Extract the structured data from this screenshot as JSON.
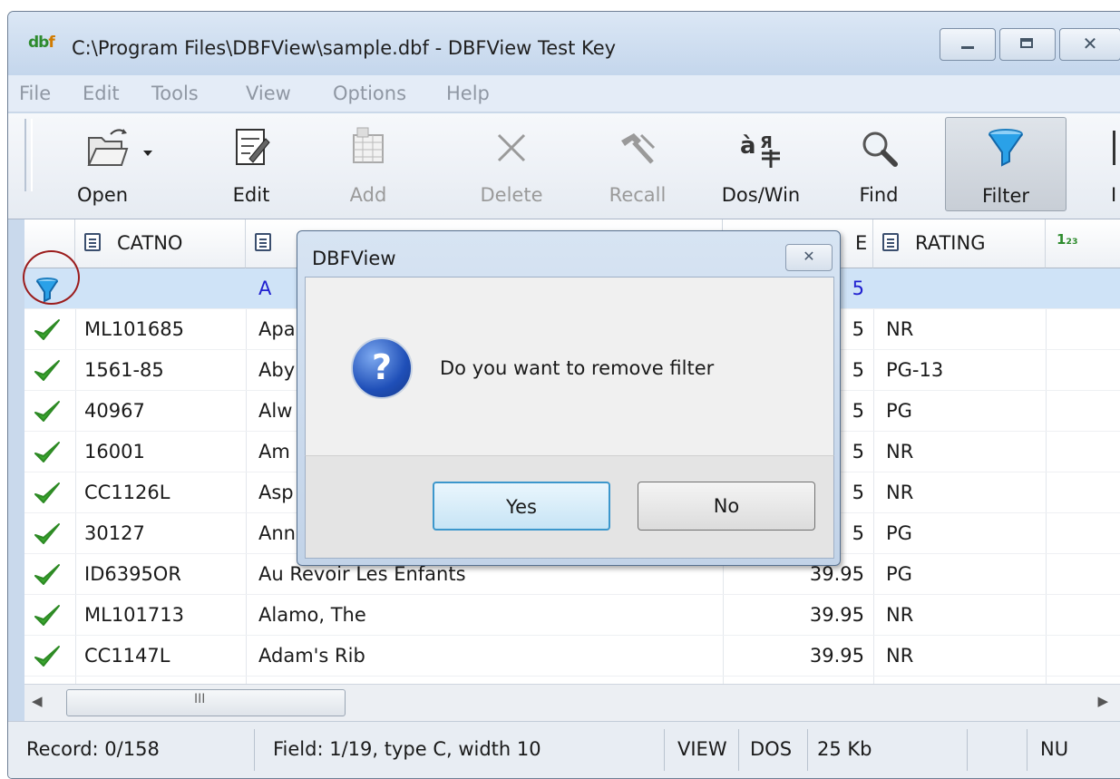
{
  "window": {
    "app_icon": "dbf",
    "title": "C:\\Program Files\\DBFView\\sample.dbf - DBFView Test Key",
    "controls": {
      "minimize": "minimize-icon",
      "maximize": "maximize-icon",
      "close": "close-icon"
    }
  },
  "menu": [
    "File",
    "Edit",
    "Tools",
    "View",
    "Options",
    "Help"
  ],
  "toolbar": {
    "buttons": [
      {
        "label": "Open",
        "icon": "open-folder-icon",
        "enabled": true
      },
      {
        "label": "Edit",
        "icon": "edit-icon",
        "enabled": true
      },
      {
        "label": "Add",
        "icon": "add-record-icon",
        "enabled": false
      },
      {
        "label": "Delete",
        "icon": "delete-icon",
        "enabled": false
      },
      {
        "label": "Recall",
        "icon": "recall-icon",
        "enabled": false
      },
      {
        "label": "Dos/Win",
        "icon": "dos-win-icon",
        "enabled": true
      },
      {
        "label": "Find",
        "icon": "find-icon",
        "enabled": true
      },
      {
        "label": "Filter",
        "icon": "filter-icon",
        "enabled": true,
        "pressed": true
      },
      {
        "label": "I",
        "icon": "",
        "enabled": true
      }
    ]
  },
  "grid": {
    "columns": [
      {
        "label": "CATNO",
        "icon": "text-field-icon"
      },
      {
        "label": "",
        "icon": "text-field-icon"
      },
      {
        "label": "E",
        "icon": ""
      },
      {
        "label": "RATING",
        "icon": "text-field-icon"
      },
      {
        "label": "",
        "icon": "numeric-field-icon",
        "icon_text": "1₂₃"
      }
    ],
    "filter_row": {
      "catno": "",
      "title": "A",
      "price": "5",
      "rating": ""
    },
    "rows": [
      {
        "catno": "ML101685",
        "title": "Apa",
        "price": "5",
        "rating": "NR"
      },
      {
        "catno": "1561-85",
        "title": "Aby",
        "price": "5",
        "rating": "PG-13"
      },
      {
        "catno": "40967",
        "title": "Alw",
        "price": "5",
        "rating": "PG"
      },
      {
        "catno": "16001",
        "title": "Am",
        "price": "5",
        "rating": "NR"
      },
      {
        "catno": "CC1126L",
        "title": "Asp",
        "price": "5",
        "rating": "NR"
      },
      {
        "catno": "30127",
        "title": "Ann",
        "price": "5",
        "rating": "PG"
      },
      {
        "catno": "ID6395OR",
        "title": "Au Revoir Les Enfants",
        "price": "39.95",
        "rating": "PG"
      },
      {
        "catno": "ML101713",
        "title": "Alamo, The",
        "price": "39.95",
        "rating": "NR"
      },
      {
        "catno": "CC1147L",
        "title": "Adam's Rib",
        "price": "39.95",
        "rating": "NR"
      }
    ],
    "scroll_thumb_grip": "III"
  },
  "status": {
    "record": "Record: 0/158",
    "field": "Field: 1/19, type C, width 10",
    "mode": "VIEW",
    "charset": "DOS",
    "size": "25 Kb",
    "extra": "",
    "num": "NU"
  },
  "dialog": {
    "title": "DBFView",
    "icon": "question-icon",
    "message": "Do you want to remove filter",
    "yes_label": "Yes",
    "no_label": "No"
  },
  "colors": {
    "filter_row_bg": "#cfe3f7",
    "filter_text": "#2020d0",
    "check": "#3aa62f",
    "annotation_circle": "#9b1c1c"
  }
}
